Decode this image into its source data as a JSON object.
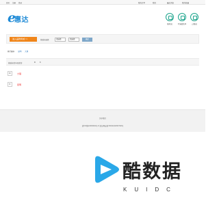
{
  "topbar": {
    "left_links": [
      "首页",
      "注册",
      "登录"
    ],
    "right_links": [
      "我的订单",
      "我的",
      "最近浏览",
      "我的收藏"
    ]
  },
  "logo": {
    "letter": "e",
    "text": "惠达"
  },
  "quick_links": [
    {
      "label": "随时退",
      "icon": "shield-icon"
    },
    {
      "label": "不满意免单",
      "icon": "badge-icon"
    },
    {
      "label": "过期退",
      "icon": "clock-icon"
    }
  ],
  "filter": {
    "enter_button": "进入品牌商城 >>",
    "label": "按城市选择",
    "province": "请选择",
    "city": "请选择",
    "search_button": "确定"
  },
  "cities": {
    "label": "热门城市:",
    "items": [
      "昆明",
      "大理"
    ]
  },
  "letters": {
    "label": "按城市首字母查找:",
    "items": [
      "D",
      "K"
    ]
  },
  "groups": [
    {
      "letter": "D",
      "city": "大理"
    },
    {
      "letter": "K",
      "city": "昆明"
    }
  ],
  "footer": {
    "about": "关于我们",
    "icp": "滇ICP备10000002号-8 滇公网安备 53011102000748号"
  },
  "watermark": {
    "title": "酷数据",
    "subtitle": "KUIDC"
  },
  "colors": {
    "brand_blue": "#1e8ad6",
    "accent_orange": "#f08519",
    "link_blue": "#1e6fb8",
    "city_red": "#ee3333",
    "icon_green": "#1aa38b"
  }
}
